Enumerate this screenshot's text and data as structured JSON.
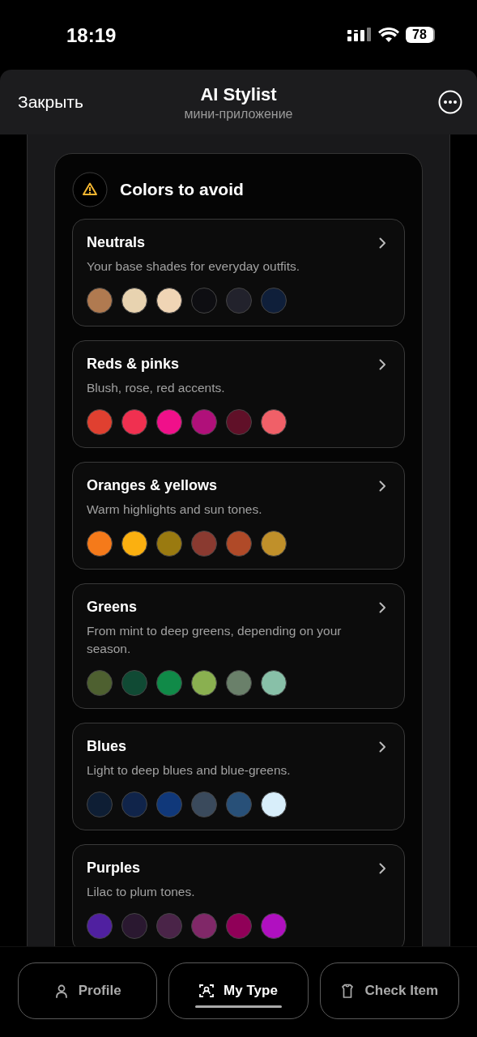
{
  "status_bar": {
    "time": "18:19",
    "battery": "78"
  },
  "header": {
    "close": "Закрыть",
    "title": "AI Stylist",
    "subtitle": "мини-приложение"
  },
  "section": {
    "title": "Colors to avoid",
    "groups": [
      {
        "title": "Neutrals",
        "description": "Your base shades for everyday outfits.",
        "swatches": [
          {
            "color": "#b07a50"
          },
          {
            "color": "#e8d3b0"
          },
          {
            "color": "#f0d5b5"
          },
          {
            "color": "#0e0e12"
          },
          {
            "color": "#22222c"
          },
          {
            "color": "#0f1f3a"
          }
        ]
      },
      {
        "title": "Reds & pinks",
        "description": "Blush, rose, red accents.",
        "swatches": [
          {
            "color": "#e04030"
          },
          {
            "color": "#f03050"
          },
          {
            "color": "#f0108a"
          },
          {
            "color": "#b0107a"
          },
          {
            "color": "#601028"
          },
          {
            "color": "#f06068"
          }
        ]
      },
      {
        "title": "Oranges & yellows",
        "description": "Warm highlights and sun tones.",
        "swatches": [
          {
            "color": "#f57a1a"
          },
          {
            "color": "#fbb010"
          },
          {
            "color": "#9a7a10"
          },
          {
            "color": "#8a3a30"
          },
          {
            "color": "#b04a28"
          },
          {
            "color": "#c0902a"
          }
        ]
      },
      {
        "title": "Greens",
        "description": "From mint to deep greens, depending on your season.",
        "swatches": [
          {
            "color": "#4e6030"
          },
          {
            "color": "#104a34"
          },
          {
            "color": "#108a48"
          },
          {
            "color": "#8ab050"
          },
          {
            "color": "#6a806a"
          },
          {
            "color": "#88c0a8"
          }
        ]
      },
      {
        "title": "Blues",
        "description": "Light to deep blues and blue-greens.",
        "swatches": [
          {
            "color": "#0e1e34"
          },
          {
            "color": "#10244a"
          },
          {
            "color": "#10387a"
          },
          {
            "color": "#3a4a5c"
          },
          {
            "color": "#285078"
          },
          {
            "color": "#d8eefa"
          }
        ]
      },
      {
        "title": "Purples",
        "description": "Lilac to plum tones.",
        "swatches": [
          {
            "color": "#5020a0"
          },
          {
            "color": "#2a1830"
          },
          {
            "color": "#4a2448"
          },
          {
            "color": "#802868"
          },
          {
            "color": "#900058"
          },
          {
            "color": "#b010c0"
          }
        ]
      }
    ]
  },
  "tabs": [
    {
      "label": "Profile",
      "kind": "person",
      "selected": false
    },
    {
      "label": "My Type",
      "kind": "scan",
      "selected": true
    },
    {
      "label": "Check Item",
      "kind": "shirt",
      "selected": false
    }
  ]
}
